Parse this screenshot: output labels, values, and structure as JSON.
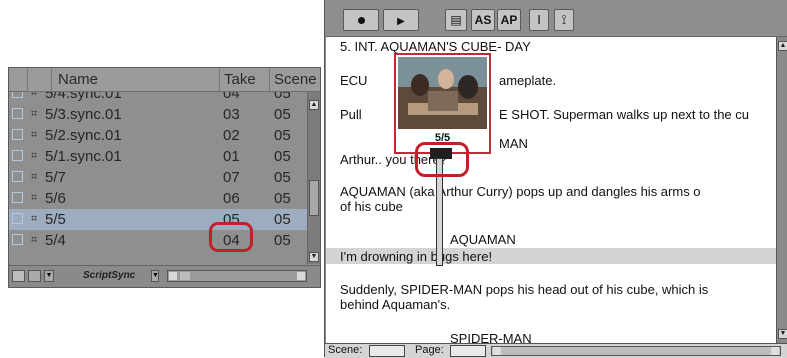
{
  "bin": {
    "columns": {
      "name": "Name",
      "take": "Take",
      "scene": "Scene"
    },
    "rows": [
      {
        "name": "5/4.sync.01",
        "take": "04",
        "scene": "05",
        "selected": false
      },
      {
        "name": "5/3.sync.01",
        "take": "03",
        "scene": "05",
        "selected": false
      },
      {
        "name": "5/2.sync.01",
        "take": "02",
        "scene": "05",
        "selected": false
      },
      {
        "name": "5/1.sync.01",
        "take": "01",
        "scene": "05",
        "selected": false
      },
      {
        "name": "5/7",
        "take": "07",
        "scene": "05",
        "selected": false
      },
      {
        "name": "5/6",
        "take": "06",
        "scene": "05",
        "selected": false
      },
      {
        "name": "5/5",
        "take": "05",
        "scene": "05",
        "selected": true
      },
      {
        "name": "5/4",
        "take": "04",
        "scene": "05",
        "selected": false
      }
    ],
    "footer": {
      "view_menu": "ScriptSync"
    }
  },
  "toolbar": {
    "as_label": "AS",
    "ap_label": "AP"
  },
  "script": {
    "lines": [
      "5. INT. AQUAMAN'S CUBE- DAY",
      "ECU",
      "ameplate.",
      "Pull",
      "E SHOT.  Superman walks up next to the cu",
      "MAN",
      "Arthur.. you there?",
      "AQUAMAN (aka Arthur Curry) pops up and dangles his arms o",
      "of his cube",
      "AQUAMAN",
      "I'm drowning in bugs here!",
      "Suddenly, SPIDER-MAN pops his head out of his cube, which is",
      "behind Aquaman's.",
      "SPIDER-MAN"
    ]
  },
  "thumbnail": {
    "label": "5/5"
  },
  "status": {
    "scene_label": "Scene:",
    "page_label": "Page:"
  },
  "colors": {
    "callout": "#c0202a",
    "selection": "#9eacbf"
  }
}
